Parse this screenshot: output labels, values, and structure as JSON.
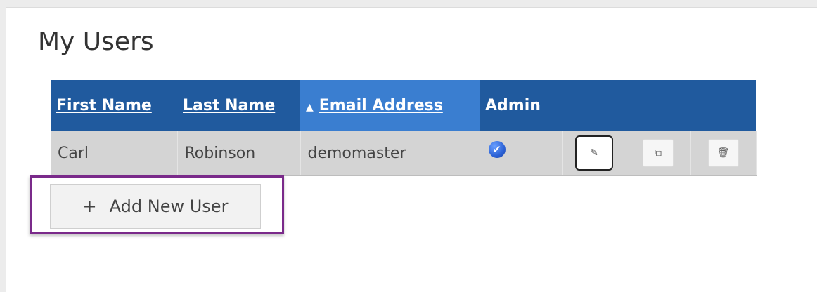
{
  "page": {
    "title": "My Users"
  },
  "table": {
    "columns": [
      {
        "label": "First Name",
        "sortable": true
      },
      {
        "label": "Last Name",
        "sortable": true
      },
      {
        "label": "Email Address",
        "sortable": true,
        "sorted": "ascending",
        "sort_indicator": "▲"
      },
      {
        "label": "Admin",
        "sortable": false
      }
    ],
    "rows": [
      {
        "first_name": "Carl",
        "last_name": "Robinson",
        "email": "demomaster",
        "admin": true,
        "admin_icon": "check-circle-icon"
      }
    ],
    "row_actions": [
      {
        "name": "edit",
        "icon": "pencil-icon",
        "glyph": "✎"
      },
      {
        "name": "copy",
        "icon": "copy-icon",
        "glyph": "⧉"
      },
      {
        "name": "delete",
        "icon": "trash-icon",
        "glyph": "🗑"
      }
    ],
    "colors": {
      "header_bg": "#205a9e",
      "header_sorted_bg": "#3a7ed0",
      "row_bg": "#d4d4d4"
    }
  },
  "actions": {
    "add_user": {
      "plus": "+",
      "label": "Add New User"
    }
  },
  "highlight": {
    "color": "#7a2a8a",
    "target": "add-new-user-button"
  }
}
